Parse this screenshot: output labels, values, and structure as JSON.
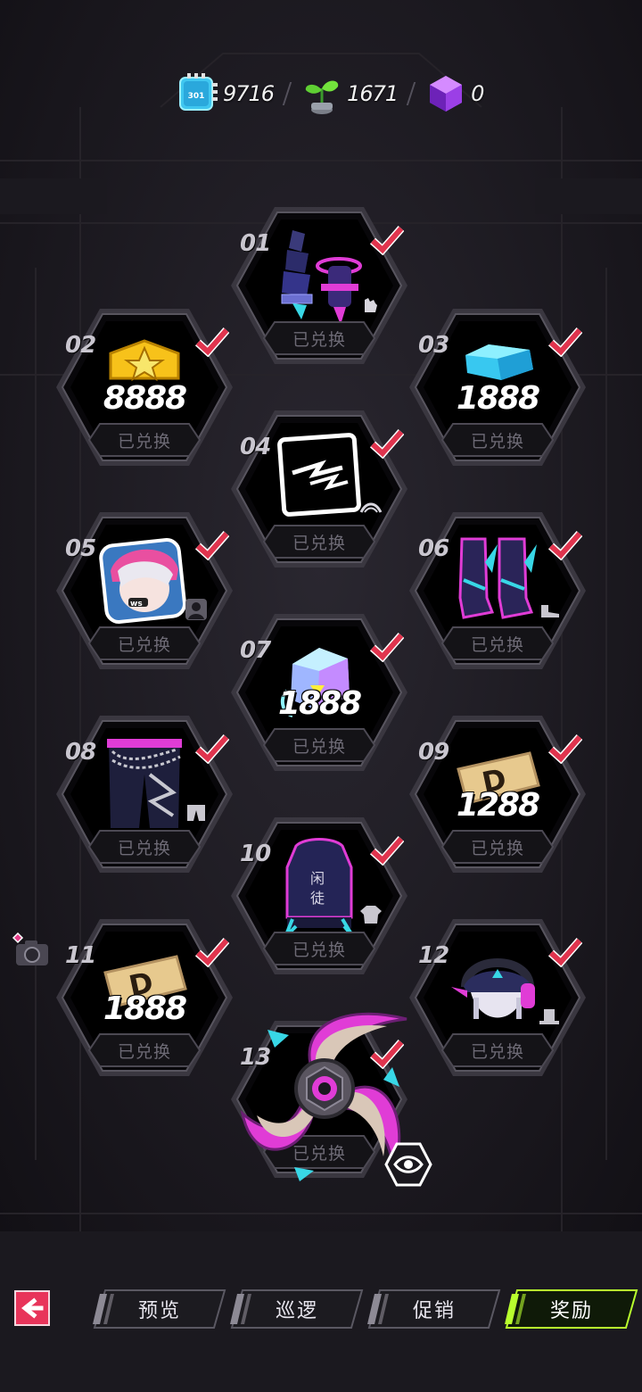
{
  "currencies": [
    {
      "name": "chip",
      "icon": "chip-currency-icon",
      "value": "9716"
    },
    {
      "name": "sprout",
      "icon": "sprout-currency-icon",
      "value": "1671"
    },
    {
      "name": "cube",
      "icon": "purple-cube-currency-icon",
      "value": "0"
    }
  ],
  "chip_label": "301",
  "rewards": [
    {
      "num": "01",
      "amount": "",
      "item": "wristbands-icon",
      "type_icon": "glove-icon",
      "status": "已兑换"
    },
    {
      "num": "02",
      "amount": "8888",
      "item": "gold-badge-icon",
      "type_icon": "",
      "status": "已兑换"
    },
    {
      "num": "03",
      "amount": "1888",
      "item": "blue-gem-icon",
      "type_icon": "",
      "status": "已兑换"
    },
    {
      "num": "04",
      "amount": "",
      "item": "lightning-emote-icon",
      "type_icon": "emote-type-icon",
      "status": "已兑换"
    },
    {
      "num": "05",
      "amount": "",
      "item": "character-avatar-icon",
      "type_icon": "avatar-type-icon",
      "status": "已兑换"
    },
    {
      "num": "06",
      "amount": "",
      "item": "neon-boots-icon",
      "type_icon": "shoe-type-icon",
      "status": "已兑换"
    },
    {
      "num": "07",
      "amount": "1888",
      "item": "neon-crystal-icon",
      "type_icon": "",
      "status": "已兑换"
    },
    {
      "num": "08",
      "amount": "",
      "item": "chain-pants-icon",
      "type_icon": "pants-type-icon",
      "status": "已兑换"
    },
    {
      "num": "09",
      "amount": "1288",
      "item": "d-ticket-icon",
      "type_icon": "",
      "status": "已兑换"
    },
    {
      "num": "10",
      "amount": "",
      "item": "hoodie-top-icon",
      "type_icon": "shirt-type-icon",
      "status": "已兑换"
    },
    {
      "num": "11",
      "amount": "1888",
      "item": "d-ticket-icon",
      "type_icon": "",
      "status": "已兑换"
    },
    {
      "num": "12",
      "amount": "",
      "item": "cap-headphones-icon",
      "type_icon": "hat-type-icon",
      "status": "已兑换"
    },
    {
      "num": "13",
      "amount": "",
      "item": "shuriken-icon",
      "type_icon": "preview-eye-icon",
      "status": "已兑换"
    }
  ],
  "tabs": [
    {
      "label": "预览",
      "active": false
    },
    {
      "label": "巡逻",
      "active": false
    },
    {
      "label": "促销",
      "active": false
    },
    {
      "label": "奖励",
      "active": true
    }
  ],
  "colors": {
    "background": "#141218",
    "check": "#e0344e",
    "accent_pink": "#e03cd6",
    "accent_cyan": "#38d7e6",
    "active_tab": "#b8ff2e",
    "back_button": "#e8345a"
  }
}
